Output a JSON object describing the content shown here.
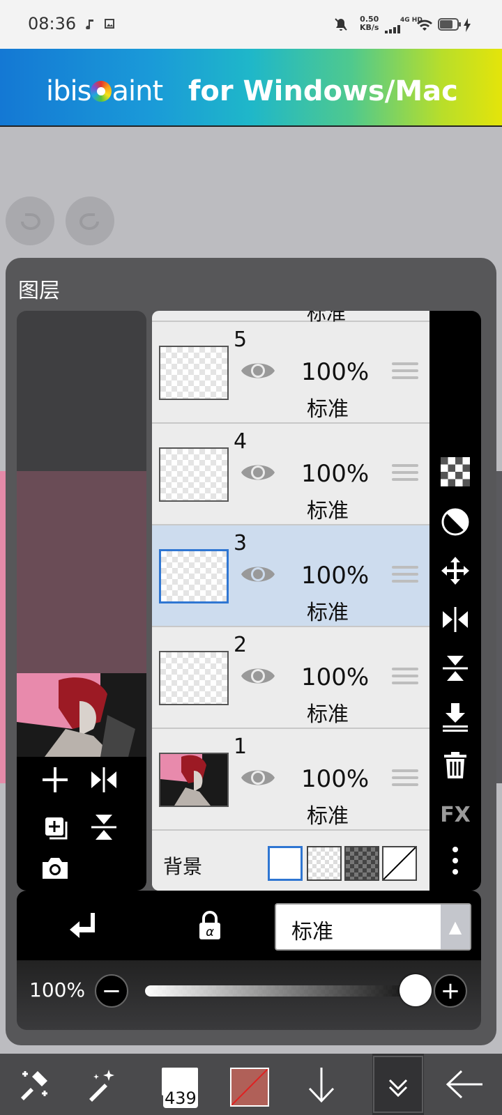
{
  "status_bar": {
    "time": "08:36",
    "net_speed_value": "0.50",
    "net_speed_unit": "KB/s",
    "net_type": "4G HD"
  },
  "banner": {
    "logo_left": "ibis",
    "logo_right": "aint",
    "tagline": "for Windows/Mac"
  },
  "panel": {
    "title": "图层",
    "layers": [
      {
        "number": "5",
        "opacity": "100%",
        "mode": "标准"
      },
      {
        "number": "4",
        "opacity": "100%",
        "mode": "标准"
      },
      {
        "number": "3",
        "opacity": "100%",
        "mode": "标准",
        "selected": true
      },
      {
        "number": "2",
        "opacity": "100%",
        "mode": "标准"
      },
      {
        "number": "1",
        "opacity": "100%",
        "mode": "标准"
      }
    ],
    "cut_mode": "标准",
    "background_label": "背景",
    "blend_mode": "标准",
    "opacity_value": "100%",
    "fx_label": "FX",
    "opacity_slider_level": 1.0
  },
  "toolbar": {
    "brush_size": "439",
    "color_hex": "#b06058"
  },
  "icons": [
    "undo-icon",
    "redo-icon",
    "add-layer-icon",
    "flip-horizontal-icon",
    "duplicate-layer-icon",
    "flip-vertical-icon",
    "camera-icon",
    "checker-icon",
    "half-circle-icon",
    "move-icon",
    "merge-down-icon",
    "trash-icon",
    "more-icon",
    "clipping-arrow-icon",
    "alpha-lock-icon",
    "transform-tool-icon",
    "magic-brush-icon",
    "download-icon",
    "chevron-down-icon",
    "back-arrow-icon",
    "eye-icon"
  ]
}
